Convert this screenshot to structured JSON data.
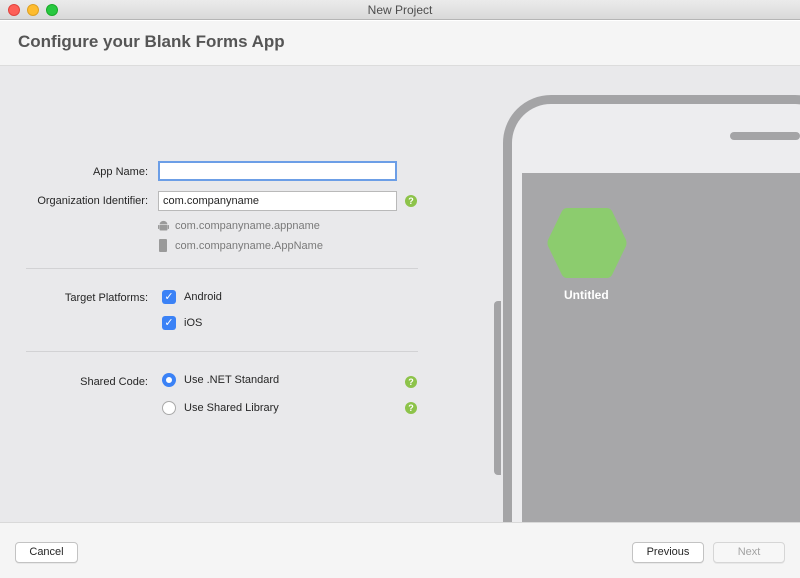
{
  "window": {
    "title": "New Project"
  },
  "header": {
    "title": "Configure your Blank Forms App"
  },
  "form": {
    "app_name": {
      "label": "App Name:",
      "value": ""
    },
    "org_identifier": {
      "label": "Organization Identifier:",
      "value": "com.companyname"
    },
    "android_bundle": "com.companyname.appname",
    "ios_bundle": "com.companyname.AppName",
    "target_platforms": {
      "label": "Target Platforms:",
      "options": [
        {
          "label": "Android",
          "checked": true
        },
        {
          "label": "iOS",
          "checked": true
        }
      ]
    },
    "shared_code": {
      "label": "Shared Code:",
      "options": [
        {
          "label": "Use .NET Standard",
          "selected": true
        },
        {
          "label": "Use Shared Library",
          "selected": false
        }
      ]
    },
    "help_glyph": "?"
  },
  "preview": {
    "app_title": "Untitled",
    "icon_color": "#8ccc6e"
  },
  "footer": {
    "cancel": "Cancel",
    "previous": "Previous",
    "next": "Next"
  }
}
